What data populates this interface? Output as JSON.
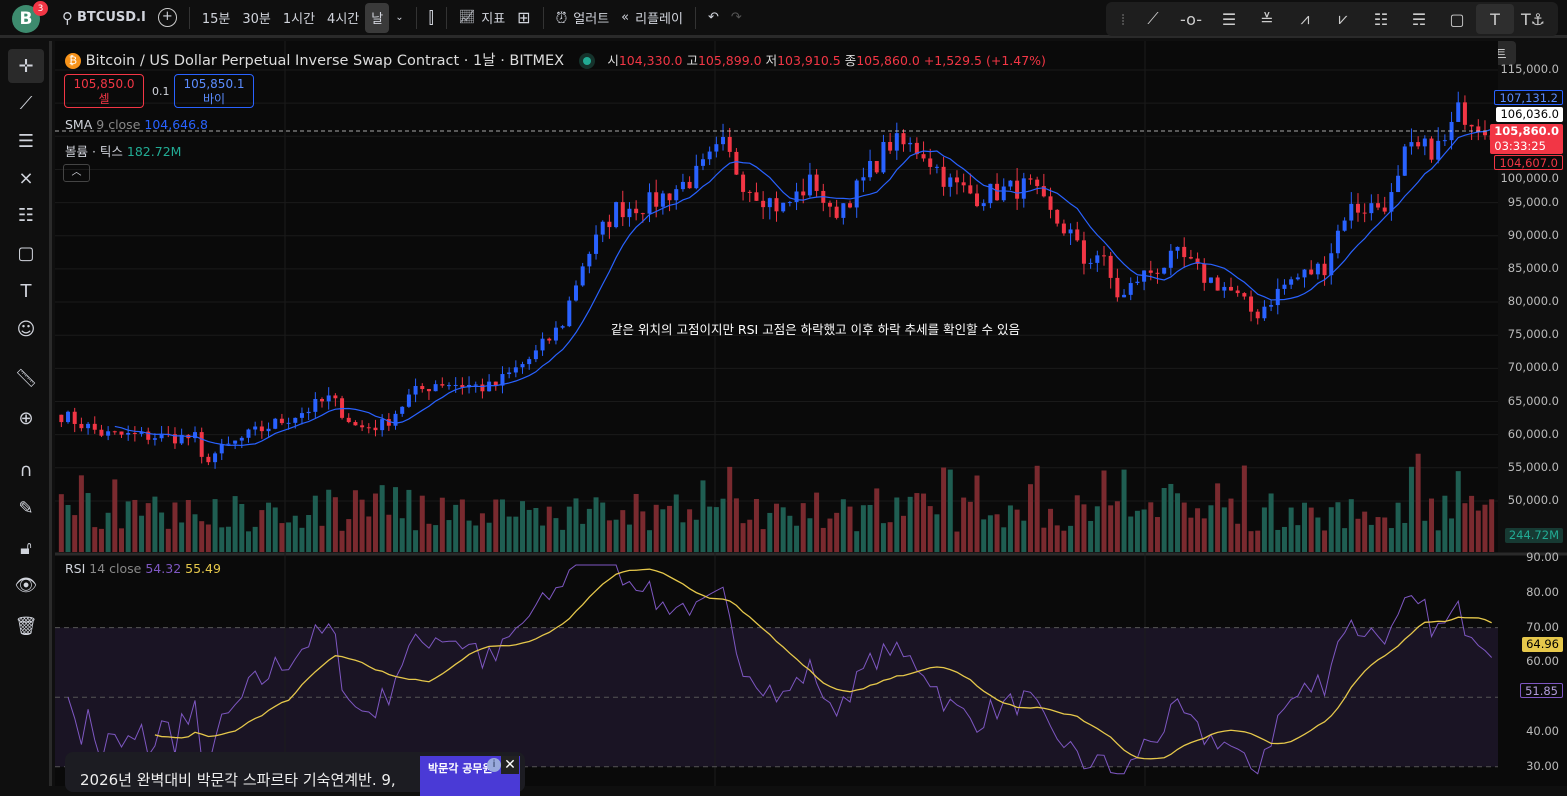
{
  "topbar": {
    "avatar": "B",
    "notifications": "3",
    "symbol": "BTCUSD.I",
    "intervals": [
      "15분",
      "30분",
      "1시간",
      "4시간",
      "날"
    ],
    "indicators_label": "지표",
    "alert_label": "얼러트",
    "replay_label": "리플레이"
  },
  "tooltip": "텍스트",
  "header": {
    "title": "Bitcoin / US Dollar Perpetual Inverse Swap Contract · 1날 · BITMEX",
    "o_label": "시",
    "o": "104,330.0",
    "h_label": "고",
    "h": "105,899.0",
    "l_label": "저",
    "l": "103,910.5",
    "c_label": "종",
    "c": "105,860.0",
    "change": "+1,529.5 (+1.47%)"
  },
  "trade": {
    "sell_price": "105,850.0",
    "sell_label": "셀",
    "spread": "0.1",
    "buy_price": "105,850.1",
    "buy_label": "바이"
  },
  "sma": {
    "name": "SMA",
    "params": "9 close",
    "value": "104,646.8"
  },
  "volume": {
    "name": "볼륨 · 틱스",
    "value": "182.72M",
    "axis_value": "244.72M"
  },
  "rsi": {
    "name": "RSI",
    "params": "14 close",
    "value": "54.32",
    "ma_value": "55.49",
    "axis_rsi": "51.85",
    "axis_ma": "64.96"
  },
  "annotation": "같은 위치의 고점이지만 RSI 고점은 하락했고 이후 하락 추세를 확인할 수 있음",
  "price_axis": {
    "labels": [
      "115,000.0",
      "100,000.0",
      "95,000.0",
      "90,000.0",
      "85,000.0",
      "80,000.0",
      "75,000.0",
      "70,000.0",
      "65,000.0",
      "60,000.0",
      "55,000.0",
      "50,000.0"
    ],
    "sma_tag": "107,131.2",
    "cross_tag": "106,036.0",
    "last_price": "105,860.0",
    "countdown": "03:33:25",
    "low_tag": "104,607.0"
  },
  "rsi_axis": {
    "labels": [
      "90.00",
      "80.00",
      "70.00",
      "60.00",
      "40.00",
      "30.00"
    ]
  },
  "ad": {
    "text": "2026년 완벽대비 박문각 스파르타 기숙연계반. 9,",
    "banner": "박문각 공무원"
  },
  "colors": {
    "up": "#f23645",
    "down": "#2962ff",
    "sma": "#2962ff",
    "rsi": "#7e57c2",
    "rsi_ma": "#e6c84b",
    "vol_up": "#7a2a2f",
    "vol_down": "#1f5e52"
  },
  "chart_data": {
    "type": "candlestick",
    "ylim": [
      48000,
      117000
    ],
    "rsi_ylim": [
      26,
      92
    ],
    "candles": 215,
    "waypoints": [
      [
        0,
        63000
      ],
      [
        8,
        60000
      ],
      [
        25,
        59500
      ],
      [
        26,
        56000
      ],
      [
        35,
        60000
      ],
      [
        45,
        63500
      ],
      [
        50,
        65500
      ],
      [
        55,
        61000
      ],
      [
        60,
        61500
      ],
      [
        65,
        66000
      ],
      [
        70,
        68000
      ],
      [
        80,
        67000
      ],
      [
        88,
        72000
      ],
      [
        93,
        76500
      ],
      [
        97,
        86000
      ],
      [
        103,
        94000
      ],
      [
        110,
        95000
      ],
      [
        118,
        99000
      ],
      [
        123,
        103500
      ],
      [
        127,
        98000
      ],
      [
        134,
        94000
      ],
      [
        140,
        98500
      ],
      [
        143,
        93000
      ],
      [
        148,
        97000
      ],
      [
        154,
        104000
      ],
      [
        160,
        103000
      ],
      [
        165,
        98000
      ],
      [
        170,
        96000
      ],
      [
        180,
        97500
      ],
      [
        184,
        93000
      ],
      [
        188,
        90000
      ],
      [
        190,
        86000
      ],
      [
        193,
        87500
      ],
      [
        197,
        80000
      ],
      [
        200,
        83500
      ],
      [
        208,
        87000
      ],
      [
        212,
        84000
      ],
      [
        217,
        82000
      ],
      [
        222,
        78000
      ],
      [
        228,
        83000
      ],
      [
        235,
        85500
      ],
      [
        239,
        94000
      ],
      [
        245,
        94500
      ],
      [
        248,
        96000
      ],
      [
        250,
        102500
      ],
      [
        257,
        103500
      ],
      [
        260,
        109000
      ],
      [
        263,
        107500
      ],
      [
        266,
        106000
      ]
    ]
  }
}
